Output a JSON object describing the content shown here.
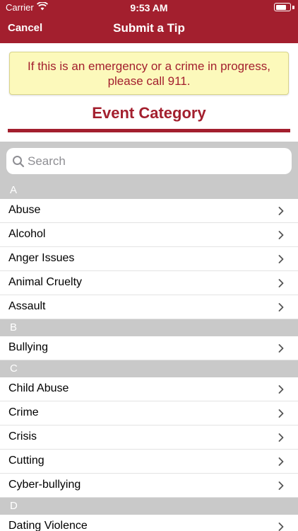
{
  "status_bar": {
    "carrier": "Carrier",
    "time": "9:53 AM"
  },
  "nav": {
    "cancel_label": "Cancel",
    "title": "Submit a Tip"
  },
  "warning": {
    "text": "If this is an emergency or a crime in progress, please call 911."
  },
  "section_title": "Event Category",
  "search": {
    "placeholder": "Search",
    "value": ""
  },
  "colors": {
    "brand": "#a31f2e",
    "warning_bg": "#fcf9bb",
    "section_header_bg": "#c9c9c9"
  },
  "categories": [
    {
      "letter": "A",
      "items": [
        "Abuse",
        "Alcohol",
        "Anger Issues",
        "Animal Cruelty",
        "Assault"
      ]
    },
    {
      "letter": "B",
      "items": [
        "Bullying"
      ]
    },
    {
      "letter": "C",
      "items": [
        "Child Abuse",
        "Crime",
        "Crisis",
        "Cutting",
        "Cyber-bullying"
      ]
    },
    {
      "letter": "D",
      "items": [
        "Dating Violence"
      ]
    }
  ]
}
